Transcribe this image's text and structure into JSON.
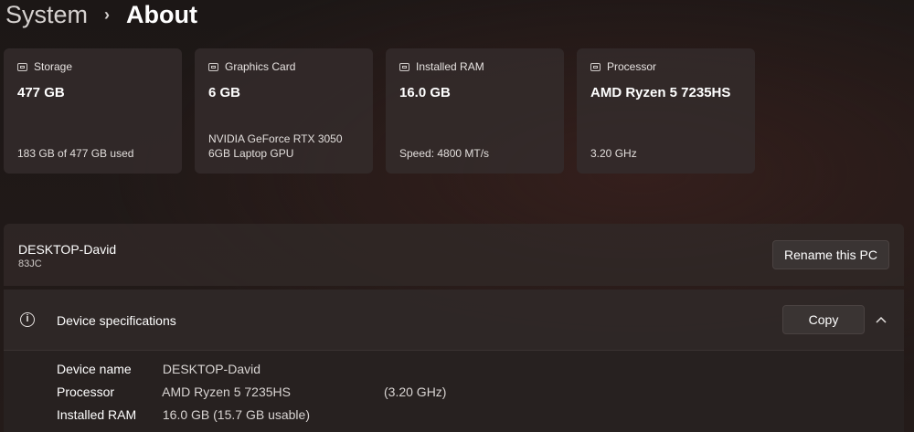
{
  "breadcrumb": {
    "parent": "System",
    "separator": "›",
    "current": "About"
  },
  "cards": [
    {
      "icon": "storage-icon",
      "title": "Storage",
      "value": "477 GB",
      "detail": "183 GB of 477 GB used"
    },
    {
      "icon": "graphics-card-icon",
      "title": "Graphics Card",
      "value": "6 GB",
      "detail": "NVIDIA GeForce RTX 3050 6GB Laptop GPU"
    },
    {
      "icon": "ram-icon",
      "title": "Installed RAM",
      "value": "16.0 GB",
      "detail": "Speed: 4800 MT/s"
    },
    {
      "icon": "processor-icon",
      "title": "Processor",
      "value": "AMD Ryzen 5 7235HS",
      "detail": "3.20 GHz"
    }
  ],
  "device": {
    "name": "DESKTOP-David",
    "model": "83JC",
    "rename_label": "Rename this PC"
  },
  "specs": {
    "title": "Device specifications",
    "copy_label": "Copy",
    "rows": [
      {
        "label": "Device name",
        "value": "DESKTOP-David",
        "extra": ""
      },
      {
        "label": "Processor",
        "value": "AMD Ryzen 5 7235HS",
        "extra": "(3.20 GHz)"
      },
      {
        "label": "Installed RAM",
        "value": "16.0 GB (15.7 GB usable)",
        "extra": ""
      }
    ]
  }
}
